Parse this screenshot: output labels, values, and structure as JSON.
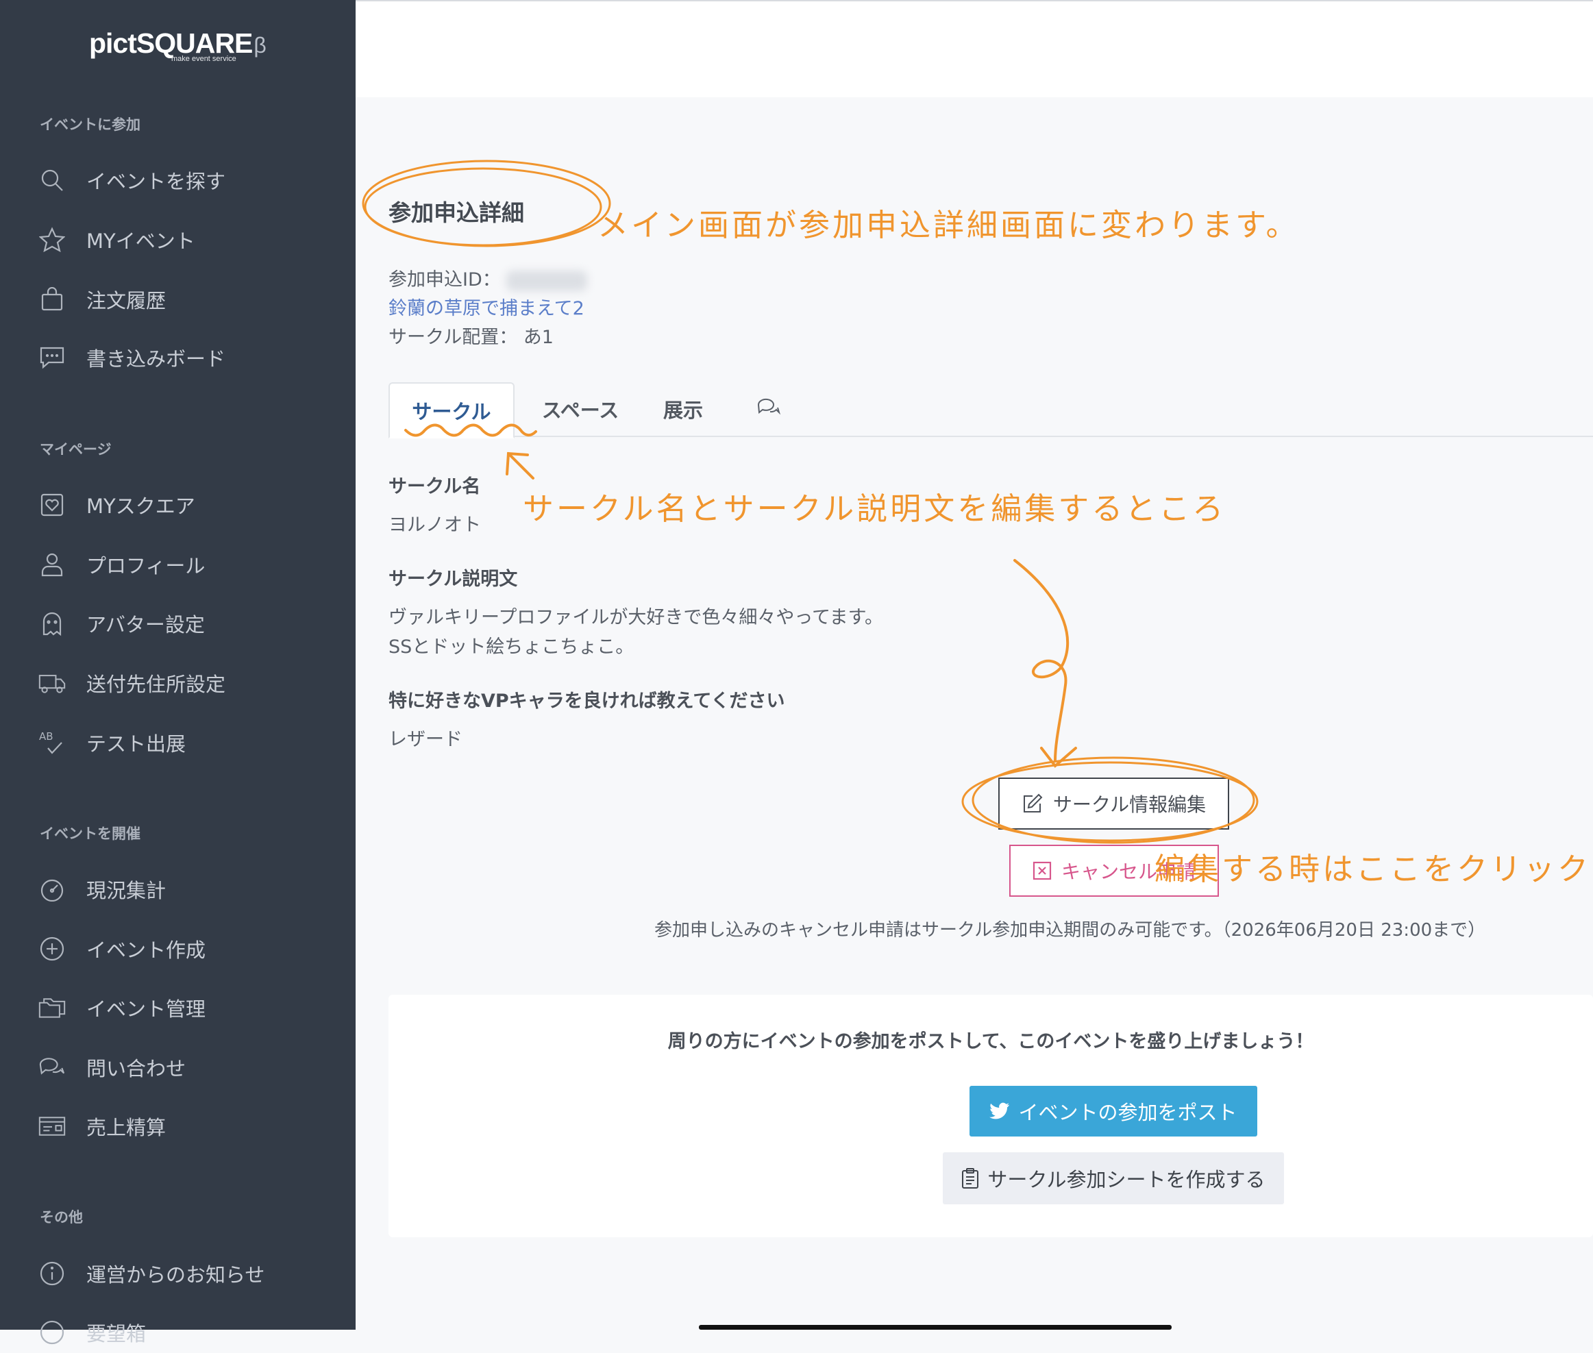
{
  "sidebar": {
    "logo": "pictSQUARE",
    "logo_beta": "β",
    "logo_sub": "make event service",
    "sections": [
      {
        "title": "イベントに参加",
        "items": [
          {
            "label": "イベントを探す",
            "icon": "search-icon"
          },
          {
            "label": "MYイベント",
            "icon": "star-icon"
          },
          {
            "label": "注文履歴",
            "icon": "bag-icon"
          },
          {
            "label": "書き込みボード",
            "icon": "chat-icon"
          }
        ]
      },
      {
        "title": "マイページ",
        "items": [
          {
            "label": "MYスクエア",
            "icon": "heart-square-icon"
          },
          {
            "label": "プロフィール",
            "icon": "user-icon"
          },
          {
            "label": "アバター設定",
            "icon": "ghost-icon"
          },
          {
            "label": "送付先住所設定",
            "icon": "truck-icon"
          },
          {
            "label": "テスト出展",
            "icon": "ab-check-icon"
          }
        ]
      },
      {
        "title": "イベントを開催",
        "items": [
          {
            "label": "現況集計",
            "icon": "gauge-icon"
          },
          {
            "label": "イベント作成",
            "icon": "plus-circle-icon"
          },
          {
            "label": "イベント管理",
            "icon": "folders-icon"
          },
          {
            "label": "問い合わせ",
            "icon": "chats-icon"
          },
          {
            "label": "売上精算",
            "icon": "card-icon"
          }
        ]
      },
      {
        "title": "その他",
        "items": [
          {
            "label": "運営からのお知らせ",
            "icon": "info-icon"
          },
          {
            "label": "要望箱",
            "icon": "chat-bubble-icon"
          }
        ]
      }
    ]
  },
  "main": {
    "title": "参加申込詳細",
    "application_id_label": "参加申込ID：",
    "event_link": "鈴蘭の草原で捕まえて2",
    "circle_placement": "サークル配置： あ1",
    "tabs": [
      {
        "label": "サークル",
        "active": true
      },
      {
        "label": "スペース",
        "active": false
      },
      {
        "label": "展示",
        "active": false
      },
      {
        "label": "",
        "icon": "comments-icon",
        "active": false
      }
    ],
    "fields": {
      "circle_name_label": "サークル名",
      "circle_name_value": "ヨルノオト",
      "circle_desc_label": "サークル説明文",
      "circle_desc_line1": "ヴァルキリープロファイルが大好きで色々細々やってます。",
      "circle_desc_line2": "SSとドット絵ちょこちょこ。",
      "question_label": "特に好きなVPキャラを良ければ教えてください",
      "question_value": "レザード"
    },
    "edit_button": "サークル情報編集",
    "cancel_button": "キャンセル申請",
    "cancel_note": "参加申し込みのキャンセル申請はサークル参加申込期間のみ可能です。（2026年06月20日 23:00まで）",
    "share": {
      "text": "周りの方にイベントの参加をポストして、このイベントを盛り上げましょう！",
      "tweet_button": "イベントの参加をポスト",
      "sheet_button": "サークル参加シートを作成する"
    }
  },
  "annotations": {
    "main_change": "メイン画面が参加申込詳細画面に変わります。",
    "edit_area": "サークル名とサークル説明文を編集するところ",
    "click_here": "編集する時はここをクリック！",
    "color": "#f0952e"
  }
}
